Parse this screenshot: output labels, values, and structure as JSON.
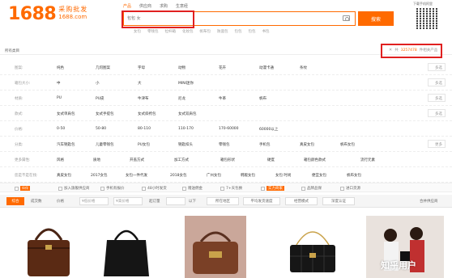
{
  "header": {
    "logo_number": "1688",
    "logo_slogan": "采购批发",
    "logo_url": "1688.com",
    "search_tabs": [
      "产品",
      "供应商",
      "求购",
      "生意经"
    ],
    "search_placeholder": "包包 女",
    "search_button": "搜索",
    "hot_words": [
      "女包",
      "零钱包",
      "拉杆箱",
      "化妆包",
      "帆布包",
      "防盗包",
      "包包",
      "包包",
      "书包"
    ],
    "qr_label": "下载手机阿里"
  },
  "breadcrumb": {
    "label": "所有类目",
    "count_text": "共",
    "count_value": "3257478",
    "count_suffix": "件相关产品"
  },
  "filters": [
    {
      "label": "图案:",
      "options": [
        "纯色",
        "几何图案",
        "字母",
        "动物",
        "花卉",
        "动漫卡通",
        "条纹"
      ],
      "more": "多选"
    },
    {
      "label": "箱包大小:",
      "options": [
        "中",
        "小",
        "大",
        "MINI迷你"
      ],
      "more": "多选"
    },
    {
      "label": "材质:",
      "options": [
        "PU",
        "PU皮",
        "牛津布",
        "尼龙",
        "牛革",
        "帆布"
      ],
      "more": "多选"
    },
    {
      "label": "款式:",
      "options": [
        "女式单肩包",
        "女式手提包",
        "女式斜挎包",
        "女式双肩包"
      ],
      "more": "多选"
    },
    {
      "label": "价格:",
      "options": [
        "0-50",
        "50-80",
        "80-110",
        "110-170",
        "170-60000",
        "60000以上"
      ],
      "more": ""
    },
    {
      "label": "分类:",
      "options": [
        "汽车钥匙包",
        "儿童零钱包",
        "PU女包",
        "钥匙扣头",
        "零钱包",
        "手机包",
        "真皮女包",
        "帆布女包"
      ],
      "more": "更多"
    },
    {
      "label": "更多属性:",
      "options": [
        "风格",
        "质地",
        "开盖方式",
        "加工方式",
        "箱包形状",
        "硬度",
        "箱包颜色款式",
        "流行元素"
      ],
      "more": ""
    },
    {
      "label": "您是不是在找:",
      "options": [
        "真皮女包",
        "2017女包",
        "女包一件代发",
        "2018女包",
        "广州女包",
        "韩版女包",
        "女包 时尚",
        "便宜女包",
        "帆布女包"
      ],
      "more": ""
    }
  ],
  "checks": [
    {
      "label": "伙伴",
      "tag": true
    },
    {
      "label": "加入旗舰供应商",
      "tag": false
    },
    {
      "label": "手机有报价",
      "tag": false
    },
    {
      "label": "48小时发货",
      "tag": false
    },
    {
      "label": "赠送佣金",
      "tag": false
    },
    {
      "label": "7+天包换",
      "tag": false
    },
    {
      "label": "实力商家",
      "tag": false
    },
    {
      "label": "品牌品保",
      "tag": false
    },
    {
      "label": "进口货源",
      "tag": false
    }
  ],
  "sortbar": {
    "active": "综合",
    "items": [
      "成交数",
      "价格"
    ],
    "price_from": "¥低价格",
    "price_to": "¥高价格",
    "moq_label": "起订量",
    "moq_unit": "以下",
    "location": "所在地区",
    "delivery": "平均发货速度",
    "model": "经营模式",
    "auth": "深度认证",
    "right_link": "合并供应商"
  },
  "watermark": "知乎用户",
  "colors": {
    "accent": "#ff6a00",
    "annotation": "#e02020"
  }
}
